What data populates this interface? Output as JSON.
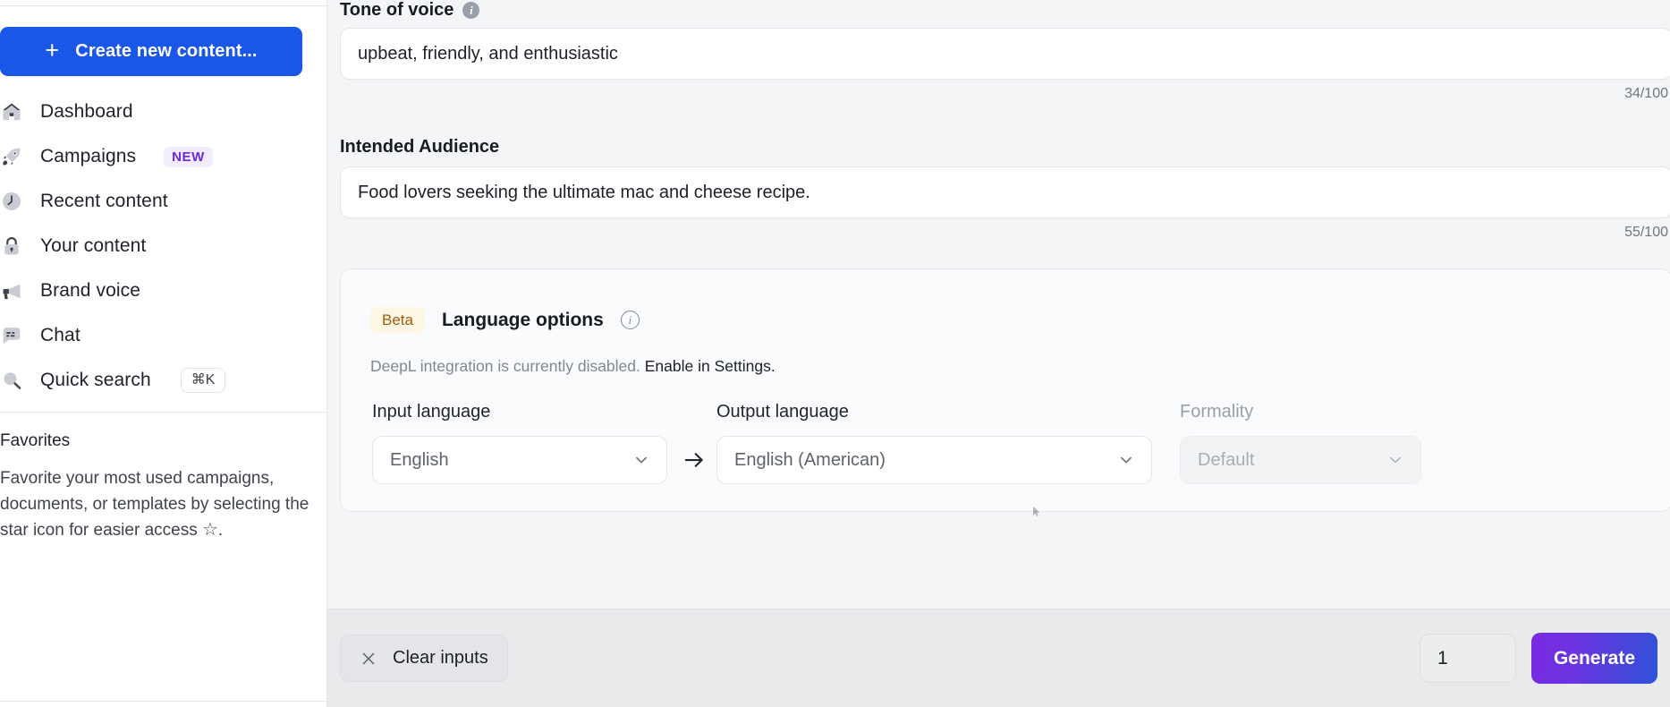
{
  "sidebar": {
    "create_button": {
      "label": "Create new content...",
      "icon": "plus-icon"
    },
    "items": [
      {
        "label": "Dashboard",
        "icon": "home-icon"
      },
      {
        "label": "Campaigns",
        "icon": "rocket-icon",
        "badge": "NEW"
      },
      {
        "label": "Recent content",
        "icon": "clock-icon"
      },
      {
        "label": "Your content",
        "icon": "lock-icon"
      },
      {
        "label": "Brand voice",
        "icon": "megaphone-icon"
      },
      {
        "label": "Chat",
        "icon": "chat-bubble-icon"
      },
      {
        "label": "Quick search",
        "icon": "search-icon",
        "shortcut": "⌘K"
      }
    ],
    "favorites": {
      "title": "Favorites",
      "description_before": "Favorite your most used campaigns, documents, or templates by selecting the star icon for easier access ",
      "star": "☆",
      "description_after": "."
    }
  },
  "main": {
    "tone": {
      "label": "Tone of voice",
      "info_icon": "info-icon",
      "value": "upbeat, friendly, and enthusiastic",
      "counter": "34/100"
    },
    "audience": {
      "label": "Intended Audience",
      "value": "Food lovers seeking the ultimate mac and cheese recipe.",
      "counter": "55/100"
    },
    "language_options": {
      "badge": "Beta",
      "title": "Language options",
      "info_icon": "info-icon",
      "note_text": "DeepL integration is currently disabled. ",
      "note_link": "Enable in Settings.",
      "input_language": {
        "label": "Input language",
        "value": "English"
      },
      "arrow_icon": "arrow-right-icon",
      "output_language": {
        "label": "Output language",
        "value": "English (American)"
      },
      "formality": {
        "label": "Formality",
        "value": "Default",
        "disabled": true
      }
    },
    "bottom_bar": {
      "clear_label": "Clear inputs",
      "clear_icon": "close-icon",
      "count_value": "1",
      "generate_label": "Generate"
    }
  },
  "colors": {
    "primary_blue": "#1a56e8",
    "badge_new_text": "#6d28d9",
    "badge_new_bg": "#f1edfd",
    "beta_text": "#a15c12",
    "beta_bg": "#fdf6e3",
    "generate_gradient_from": "#7829e0",
    "generate_gradient_to": "#2f52d8",
    "main_bg": "#f4f5f7"
  }
}
